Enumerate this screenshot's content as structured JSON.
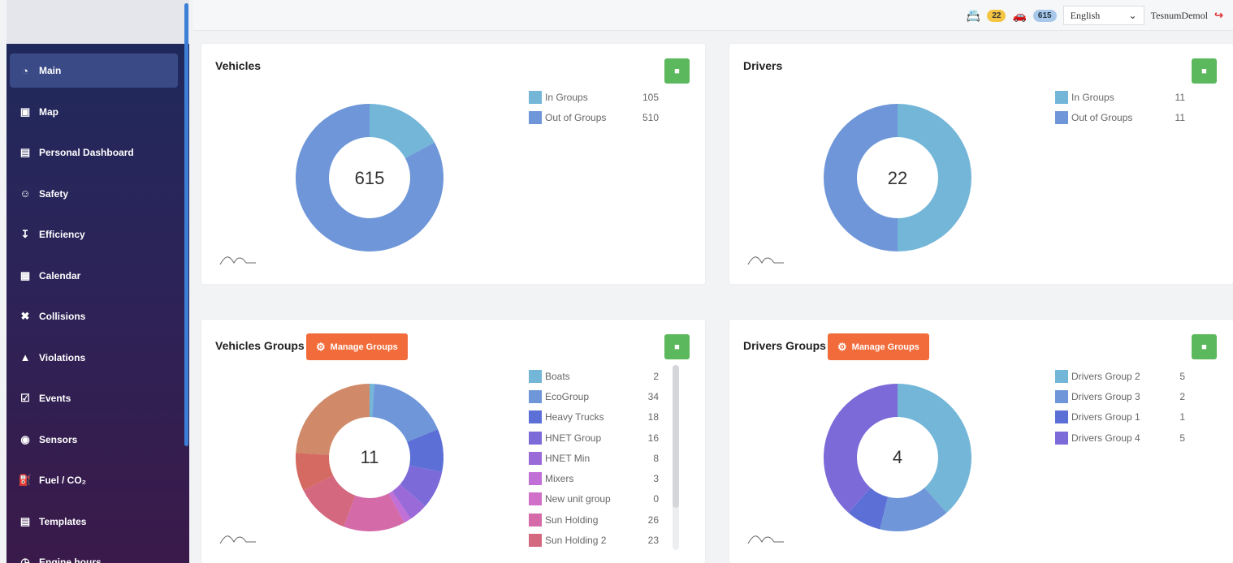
{
  "sidebar": {
    "items": [
      {
        "label": "Main",
        "icon": "pie-chart-icon",
        "active": true
      },
      {
        "label": "Map",
        "icon": "map-icon"
      },
      {
        "label": "Personal Dashboard",
        "icon": "id-card-icon"
      },
      {
        "label": "Safety",
        "icon": "user-shield-icon"
      },
      {
        "label": "Efficiency",
        "icon": "hand-coin-icon"
      },
      {
        "label": "Calendar",
        "icon": "calendar-icon"
      },
      {
        "label": "Collisions",
        "icon": "collision-car-icon"
      },
      {
        "label": "Violations",
        "icon": "warning-icon"
      },
      {
        "label": "Events",
        "icon": "calendar-check-icon"
      },
      {
        "label": "Sensors",
        "icon": "gauge-icon"
      },
      {
        "label": "Fuel / CO₂",
        "icon": "fuel-pump-icon"
      },
      {
        "label": "Templates",
        "icon": "table-icon"
      },
      {
        "label": "Engine hours",
        "icon": "clock-icon"
      }
    ]
  },
  "topbar": {
    "drivers_count": "22",
    "vehicles_count": "615",
    "language": "English",
    "username": "TesnumDemol"
  },
  "vehicles": {
    "title": "Vehicles",
    "total": "615",
    "legend": [
      {
        "label": "In Groups",
        "value": 105,
        "color": "#73b6d8"
      },
      {
        "label": "Out of Groups",
        "value": 510,
        "color": "#6e96d8"
      }
    ]
  },
  "drivers": {
    "title": "Drivers",
    "total": "22",
    "legend": [
      {
        "label": "In Groups",
        "value": 11,
        "color": "#73b6d8"
      },
      {
        "label": "Out of Groups",
        "value": 11,
        "color": "#6e96d8"
      }
    ]
  },
  "vehicles_groups": {
    "title": "Vehicles Groups",
    "manage_label": "Manage Groups",
    "total": "11",
    "legend": [
      {
        "label": "Boats",
        "value": 2,
        "color": "#73b6d8"
      },
      {
        "label": "EcoGroup",
        "value": 34,
        "color": "#6e96d8"
      },
      {
        "label": "Heavy Trucks",
        "value": 18,
        "color": "#5b6fd6"
      },
      {
        "label": "HNET Group",
        "value": 16,
        "color": "#7b6ad8"
      },
      {
        "label": "HNET Min",
        "value": 8,
        "color": "#9a6ad8"
      },
      {
        "label": "Mixers",
        "value": 3,
        "color": "#c070d6"
      },
      {
        "label": "New unit group",
        "value": 0,
        "color": "#d070c8"
      },
      {
        "label": "Sun Holding",
        "value": 26,
        "color": "#d46aa8"
      },
      {
        "label": "Sun Holding 2",
        "value": 23,
        "color": "#d4687f"
      }
    ],
    "extra_segments": [
      {
        "value": 16,
        "color": "#d46a62"
      },
      {
        "value": 46,
        "color": "#d08a6a"
      }
    ]
  },
  "drivers_groups": {
    "title": "Drivers Groups",
    "manage_label": "Manage Groups",
    "total": "4",
    "legend": [
      {
        "label": "Drivers Group 2",
        "value": 5,
        "color": "#73b6d8"
      },
      {
        "label": "Drivers Group 3",
        "value": 2,
        "color": "#6e96d8"
      },
      {
        "label": "Drivers Group 1",
        "value": 1,
        "color": "#5b6fd6"
      },
      {
        "label": "Drivers Group 4",
        "value": 5,
        "color": "#7b6ad8"
      }
    ]
  }
}
